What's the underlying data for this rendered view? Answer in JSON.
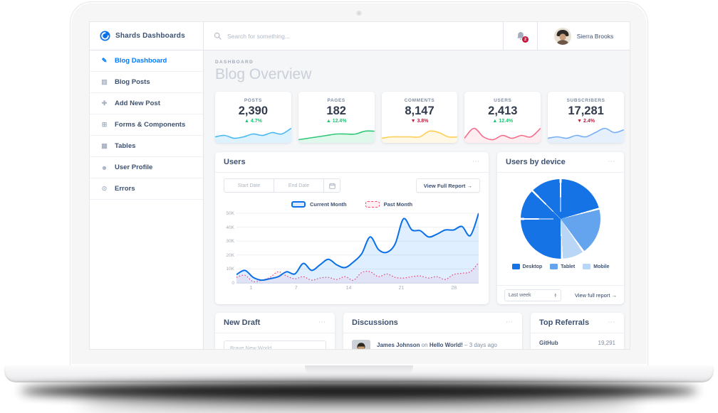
{
  "navbar": {
    "brand": "Shards Dashboards",
    "search_placeholder": "Search for something...",
    "notification_count": "2",
    "user_name": "Sierra Brooks"
  },
  "sidebar": {
    "items": [
      {
        "label": "Blog Dashboard",
        "icon": "pencil",
        "active": true
      },
      {
        "label": "Blog Posts",
        "icon": "posts",
        "active": false
      },
      {
        "label": "Add New Post",
        "icon": "add",
        "active": false
      },
      {
        "label": "Forms & Components",
        "icon": "forms",
        "active": false
      },
      {
        "label": "Tables",
        "icon": "table",
        "active": false
      },
      {
        "label": "User Profile",
        "icon": "person",
        "active": false
      },
      {
        "label": "Errors",
        "icon": "error",
        "active": false
      }
    ]
  },
  "page": {
    "eyebrow": "DASHBOARD",
    "title": "Blog Overview"
  },
  "stats": [
    {
      "label": "POSTS",
      "value": "2,390",
      "delta": "4.7%",
      "direction": "up",
      "spark_color": "#49b8f5",
      "spark_fill": "rgba(73,184,245,0.18)",
      "spark": [
        3,
        4,
        2,
        3,
        5,
        4,
        6,
        5,
        9
      ]
    },
    {
      "label": "PAGES",
      "value": "182",
      "delta": "12.4%",
      "direction": "up",
      "spark_color": "#2ec776",
      "spark_fill": "rgba(46,199,118,0.15)",
      "spark": [
        1,
        2,
        3,
        4,
        5,
        5,
        5,
        7,
        7
      ]
    },
    {
      "label": "COMMENTS",
      "value": "8,147",
      "delta": "3.8%",
      "direction": "down",
      "spark_color": "#ffce55",
      "spark_fill": "rgba(255,206,85,0.15)",
      "spark": [
        2,
        3,
        3,
        3,
        3,
        7,
        6,
        3,
        3
      ]
    },
    {
      "label": "USERS",
      "value": "2,413",
      "delta": "12.4%",
      "direction": "up",
      "spark_color": "#f66c8a",
      "spark_fill": "rgba(246,108,138,0.12)",
      "spark": [
        2,
        9,
        3,
        1,
        4,
        2,
        4,
        3,
        9
      ]
    },
    {
      "label": "SUBSCRIBERS",
      "value": "17,281",
      "delta": "2.4%",
      "direction": "down",
      "spark_color": "#74aef6",
      "spark_fill": "rgba(116,174,246,0.18)",
      "spark": [
        2,
        3,
        2,
        4,
        3,
        6,
        9,
        6,
        8
      ]
    }
  ],
  "status_colors": {
    "up": "#17c671",
    "down": "#c4183c"
  },
  "users_card": {
    "title": "Users",
    "start_date_placeholder": "Start Date",
    "end_date_placeholder": "End Date",
    "report_button": "View Full Report →",
    "legend_current": "Current Month",
    "legend_past": "Past Month"
  },
  "device_card": {
    "title": "Users by device",
    "legend": [
      {
        "label": "Desktop",
        "color": "#1673e6"
      },
      {
        "label": "Tablet",
        "color": "#64a3ee"
      },
      {
        "label": "Mobile",
        "color": "#bad6f6"
      }
    ],
    "select_value": "Last week",
    "link": "View full report →"
  },
  "draft_card": {
    "title": "New Draft",
    "input_placeholder": "Brave New World"
  },
  "discussions_card": {
    "title": "Discussions",
    "author": "James Johnson",
    "connector": "on",
    "post_title": "Hello World!",
    "time": "– 3 days ago"
  },
  "referrals_card": {
    "title": "Top Referrals",
    "rows": [
      {
        "name": "GitHub",
        "value": "19,291"
      }
    ]
  },
  "chart_data": [
    {
      "id": "users_line",
      "type": "line",
      "title": "Users",
      "x_ticks": [
        1,
        7,
        14,
        21,
        28
      ],
      "y_ticks": [
        "0",
        "10K",
        "20K",
        "30K",
        "40K",
        "50K"
      ],
      "ylim": [
        0,
        50000
      ],
      "grid": true,
      "legend_position": "top",
      "unit": "thousands",
      "series": [
        {
          "name": "Current Month",
          "style": "solid",
          "color": "#0b70e8",
          "fill": "rgba(0,123,255,0.12)",
          "values": [
            6,
            9,
            4,
            2,
            3,
            4.5,
            8,
            6.5,
            14,
            9,
            13,
            17,
            13,
            11,
            15,
            21,
            33,
            24,
            22,
            28,
            46,
            38,
            37.5,
            33,
            35,
            38,
            38,
            40.5,
            34,
            50
          ]
        },
        {
          "name": "Past Month",
          "style": "dotted",
          "color": "#ff4169",
          "fill": "rgba(255,65,105,0.07)",
          "values": [
            4,
            5.5,
            1,
            2,
            4,
            8,
            5,
            3,
            4.5,
            2,
            3.5,
            4,
            2.5,
            4.5,
            2,
            7.5,
            8,
            4.5,
            6.5,
            4,
            3.5,
            4.5,
            5,
            3.5,
            4.5,
            2.5,
            6,
            7,
            8,
            14.5
          ]
        }
      ]
    },
    {
      "id": "users_by_device",
      "type": "pie",
      "legend": [
        "Desktop",
        "Tablet",
        "Mobile"
      ],
      "slices": [
        {
          "from": 0,
          "to": 75,
          "color": "#1673e6",
          "name": "Desktop"
        },
        {
          "from": 75,
          "to": 145,
          "color": "#64a3ee",
          "name": "Tablet"
        },
        {
          "from": 145,
          "to": 178,
          "color": "#bad6f6",
          "name": "Mobile"
        },
        {
          "from": 178,
          "to": 270,
          "color": "#1673e6",
          "name": "Desktop"
        },
        {
          "from": 270,
          "to": 315,
          "color": "#1673e6",
          "name": "Desktop"
        },
        {
          "from": 315,
          "to": 360,
          "color": "#1673e6",
          "name": "Desktop"
        }
      ]
    }
  ]
}
